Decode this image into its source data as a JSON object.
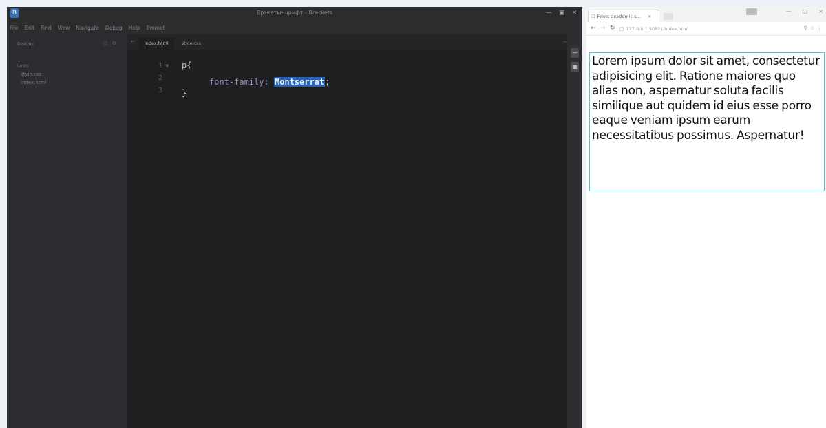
{
  "editor": {
    "window_title": "Брэкеты-шрифт - Brackets",
    "menu": [
      "File",
      "Edit",
      "Find",
      "View",
      "Navigate",
      "Debug",
      "Help",
      "Emmet"
    ],
    "sidebar": {
      "header": "Файлы",
      "items": [
        "fonts",
        "style.css",
        "index.html"
      ]
    },
    "tabs": [
      {
        "label": "index.html"
      },
      {
        "label": "style.css"
      }
    ],
    "code": {
      "line_numbers": [
        "1",
        "2",
        "3"
      ],
      "line1_selector": "p",
      "line1_brace": "{",
      "line2_property": "font-family:",
      "line2_value": "Montserrat",
      "line2_semicolon": ";",
      "line3_brace": "}"
    }
  },
  "browser": {
    "tab_title": "Fonts-academic-s...",
    "url": "127.0.0.1:50821/index.html",
    "paragraph": "Lorem ipsum dolor sit amet, consectetur adipisicing elit. Ratione maiores quo alias non, aspernatur soluta facilis similique aut quidem id eius esse porro eaque veniam ipsum earum necessitatibus possimus. Aspernatur!"
  },
  "colors": {
    "editor_bg": "#1d1f21",
    "sidebar_bg": "#2b2d30",
    "selection": "#2862b8",
    "paragraph_border": "#4fc6d6"
  }
}
